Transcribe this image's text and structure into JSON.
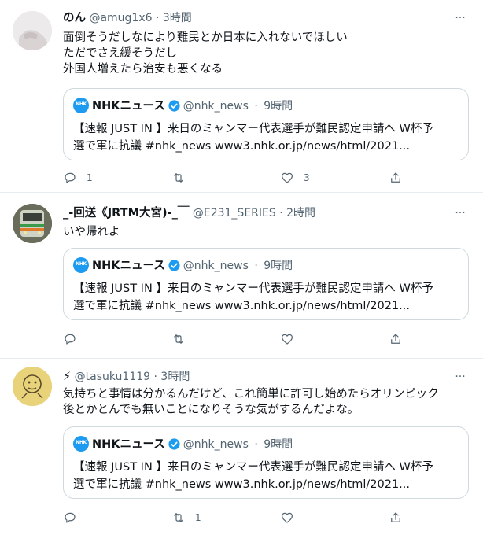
{
  "tweets": [
    {
      "name": "のん",
      "handle": "@amug1x6",
      "separator": "·",
      "time": "3時間",
      "lines": [
        "面倒そうだしなにより難民とか日本に入れないでほしい",
        "ただでさえ緩そうだし",
        "外国人増えたら治安も悪くなる"
      ],
      "quote": {
        "logo_text": "NHK",
        "name": "NHKニュース",
        "handle": "@nhk_news",
        "separator": "·",
        "time": "9時間",
        "lines": [
          "【速報 JUST IN 】来日のミャンマー代表選手が難民認定申請へ W杯予",
          "選で軍に抗議 #nhk_news www3.nhk.or.jp/news/html/2021..."
        ]
      },
      "reply_count": "1",
      "retweet_count": "",
      "like_count": "3"
    },
    {
      "name": "_-回送《JRTM大宮)-_￣",
      "handle": "@E231_SERIES",
      "separator": "·",
      "time": "2時間",
      "lines": [
        "いや帰れよ"
      ],
      "quote": {
        "logo_text": "NHK",
        "name": "NHKニュース",
        "handle": "@nhk_news",
        "separator": "·",
        "time": "9時間",
        "lines": [
          "【速報 JUST IN 】来日のミャンマー代表選手が難民認定申請へ W杯予",
          "選で軍に抗議 #nhk_news www3.nhk.or.jp/news/html/2021..."
        ]
      },
      "reply_count": "",
      "retweet_count": "",
      "like_count": ""
    },
    {
      "name": "⚡",
      "handle": "@tasuku1119",
      "separator": "·",
      "time": "3時間",
      "lines": [
        "気持ちと事情は分かるんだけど、これ簡単に許可し始めたらオリンピック",
        "後とかとんでも無いことになりそうな気がするんだよな。"
      ],
      "quote": {
        "logo_text": "NHK",
        "name": "NHKニュース",
        "handle": "@nhk_news",
        "separator": "·",
        "time": "9時間",
        "lines": [
          "【速報 JUST IN 】来日のミャンマー代表選手が難民認定申請へ W杯予",
          "選で軍に抗議 #nhk_news www3.nhk.or.jp/news/html/2021..."
        ]
      },
      "reply_count": "",
      "retweet_count": "1",
      "like_count": ""
    }
  ],
  "more_label": "···",
  "colors": {
    "accent": "#1d9bf0",
    "muted": "#536471",
    "text": "#0f1419",
    "border": "#cfd9de"
  },
  "icons": [
    "reply-icon",
    "retweet-icon",
    "like-icon",
    "share-icon",
    "verified-badge-icon",
    "more-icon"
  ]
}
